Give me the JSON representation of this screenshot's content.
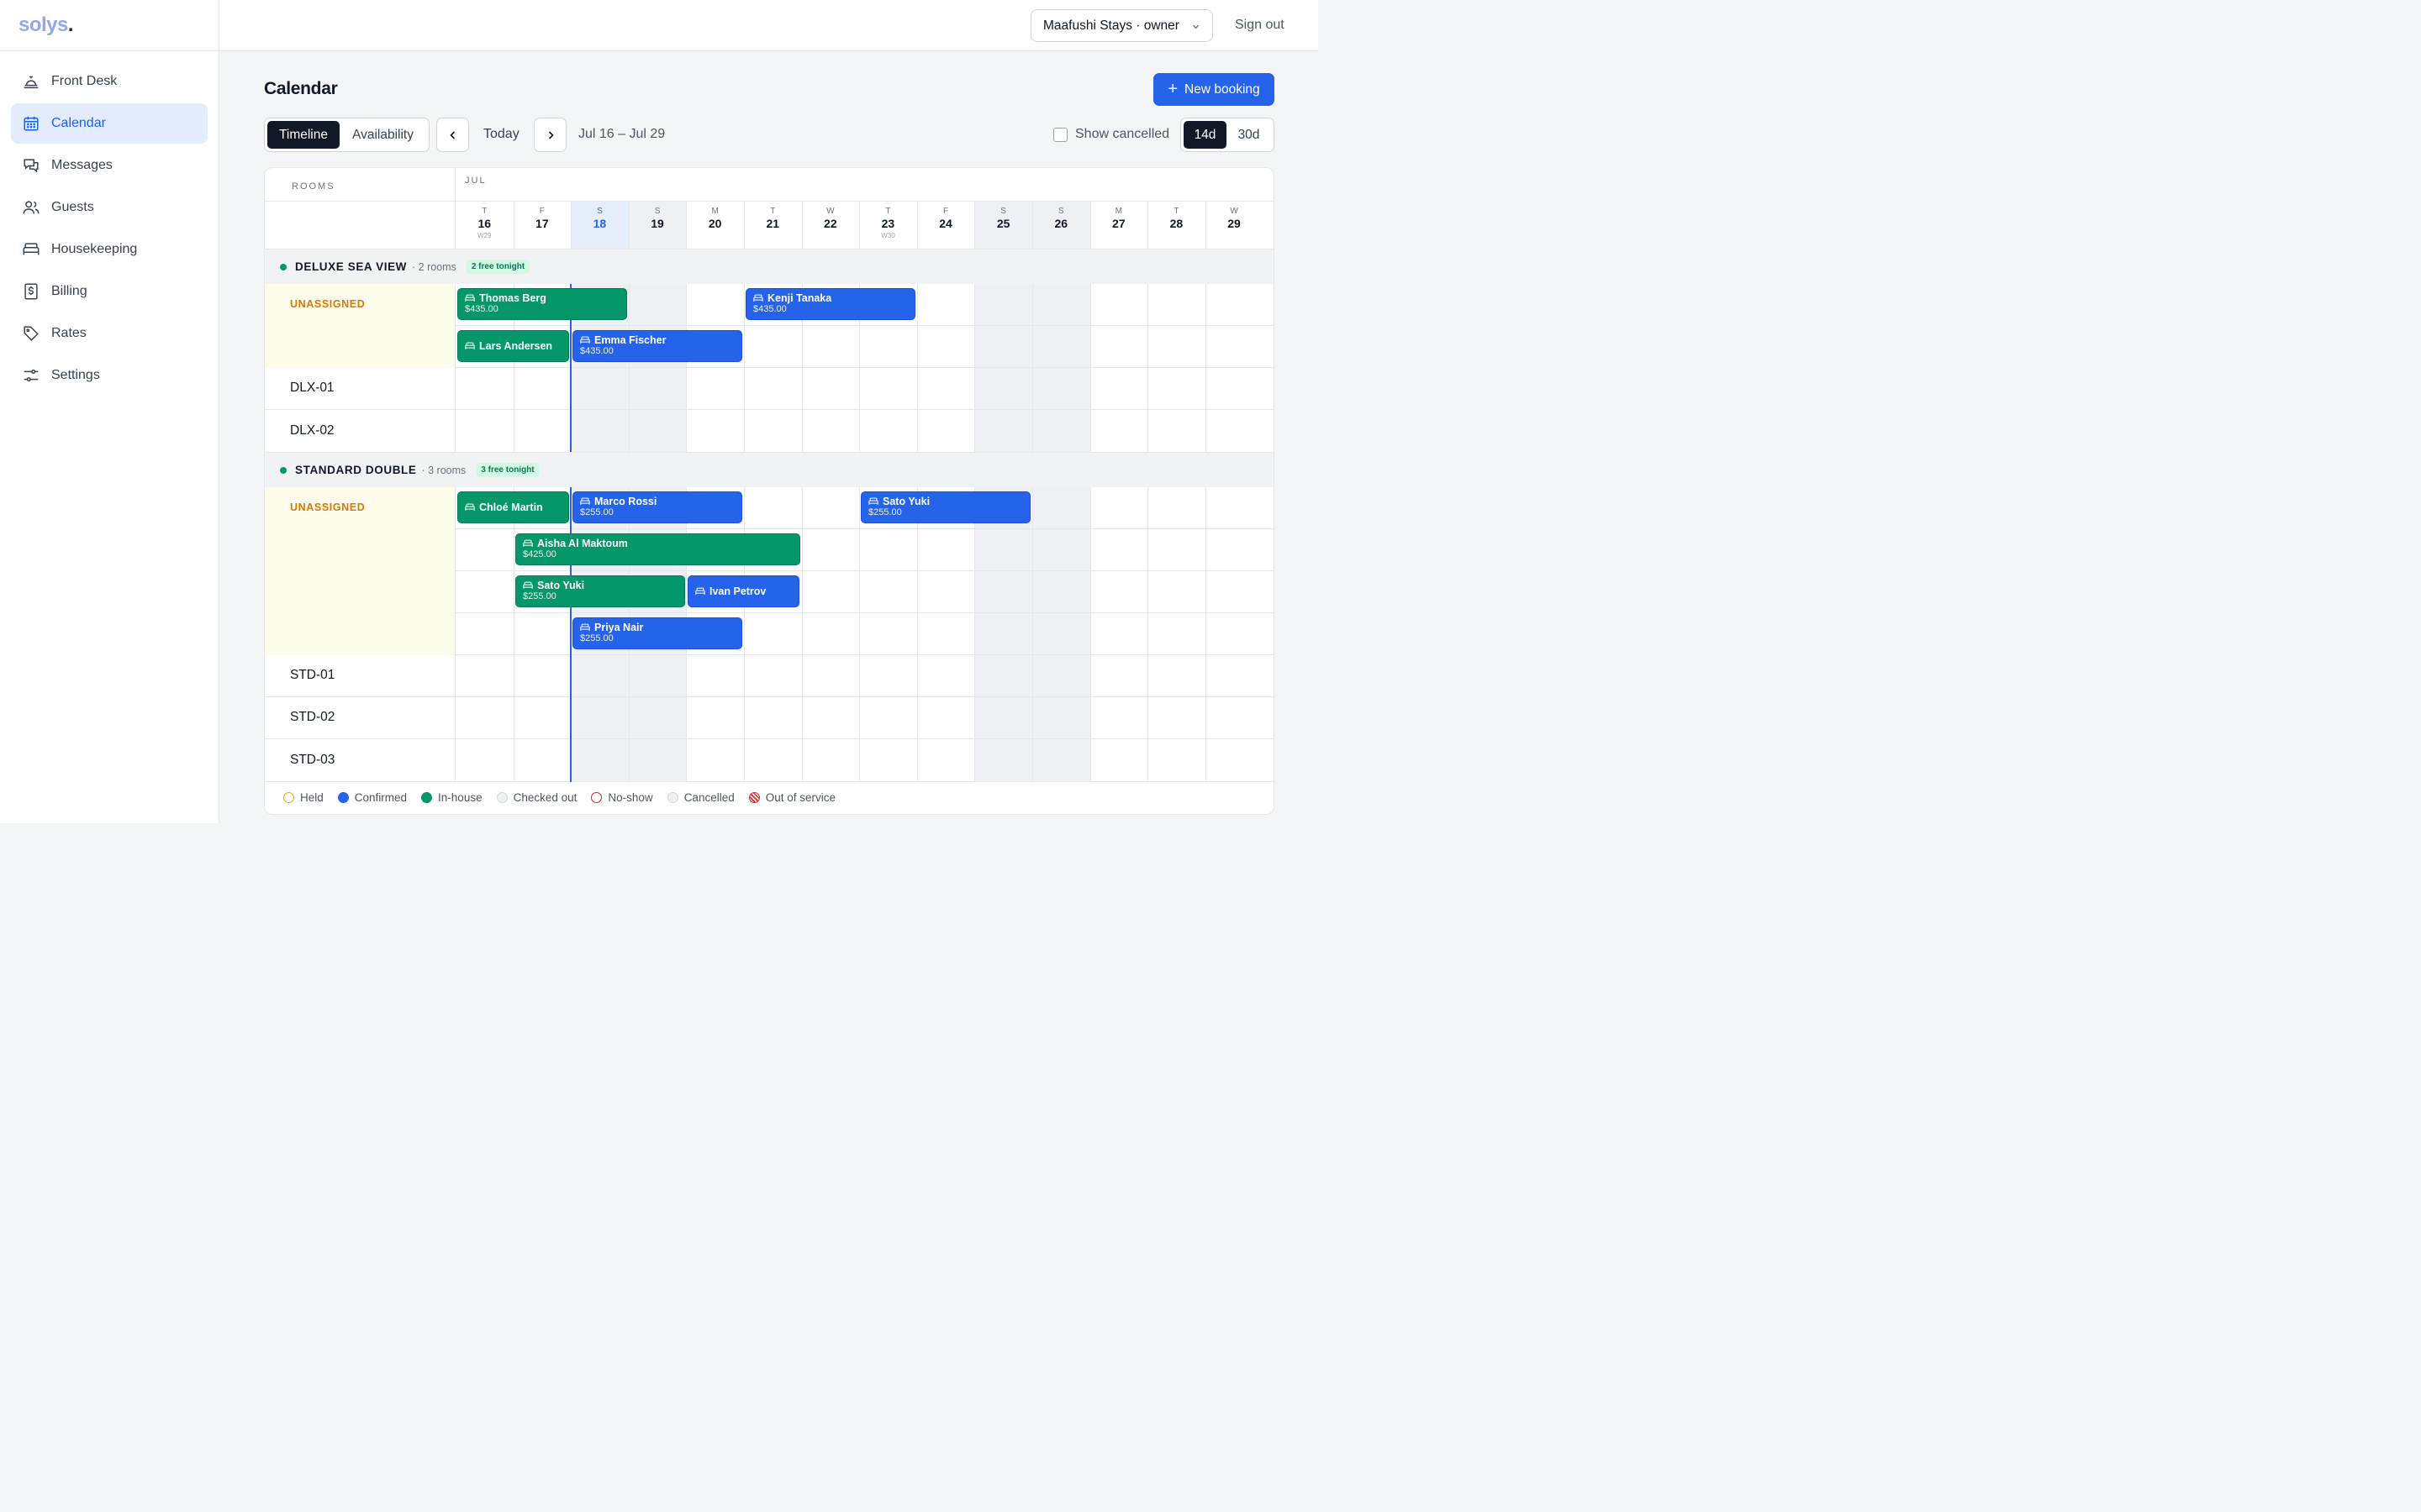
{
  "app": {
    "logo": "solys",
    "logo_dot": "."
  },
  "sidebar": {
    "items": [
      {
        "label": "Front Desk",
        "icon": "bell-icon"
      },
      {
        "label": "Calendar",
        "icon": "calendar-icon",
        "active": true
      },
      {
        "label": "Messages",
        "icon": "messages-icon"
      },
      {
        "label": "Guests",
        "icon": "users-icon"
      },
      {
        "label": "Housekeeping",
        "icon": "bed-icon"
      },
      {
        "label": "Billing",
        "icon": "dollar-icon"
      },
      {
        "label": "Rates",
        "icon": "tag-icon"
      },
      {
        "label": "Settings",
        "icon": "sliders-icon"
      }
    ]
  },
  "topbar": {
    "property": "Maafushi Stays · owner",
    "sign_out": "Sign out"
  },
  "header": {
    "title": "Calendar",
    "new_booking": "New booking",
    "views": [
      "Timeline",
      "Availability"
    ],
    "today": "Today",
    "range": "Jul 16 – Jul 29",
    "show_cancelled": "Show cancelled",
    "spans": [
      "14d",
      "30d"
    ]
  },
  "calendar": {
    "rooms_header": "ROOMS",
    "month": "JUL",
    "days": [
      {
        "dow": "T",
        "num": "16",
        "week": "W29"
      },
      {
        "dow": "F",
        "num": "17"
      },
      {
        "dow": "S",
        "num": "18",
        "today": true
      },
      {
        "dow": "S",
        "num": "19"
      },
      {
        "dow": "M",
        "num": "20"
      },
      {
        "dow": "T",
        "num": "21"
      },
      {
        "dow": "W",
        "num": "22"
      },
      {
        "dow": "T",
        "num": "23",
        "week": "W30"
      },
      {
        "dow": "F",
        "num": "24"
      },
      {
        "dow": "S",
        "num": "25"
      },
      {
        "dow": "S",
        "num": "26"
      },
      {
        "dow": "M",
        "num": "27"
      },
      {
        "dow": "T",
        "num": "28"
      },
      {
        "dow": "W",
        "num": "29"
      }
    ],
    "groups": [
      {
        "name": "DELUXE SEA VIEW",
        "count": "· 2 rooms",
        "badge": "2 free tonight",
        "unassigned_label": "UNASSIGNED",
        "rooms": [
          "DLX-01",
          "DLX-02"
        ]
      },
      {
        "name": "STANDARD DOUBLE",
        "count": "· 3 rooms",
        "badge": "3 free tonight",
        "unassigned_label": "UNASSIGNED",
        "rooms": [
          "STD-01",
          "STD-02",
          "STD-03"
        ]
      }
    ],
    "bookings": [
      {
        "guest": "Thomas Berg",
        "price": "$435.00",
        "status": "in-house",
        "start": 0,
        "nights": 3,
        "group": 0,
        "lane": 0
      },
      {
        "guest": "Kenji Tanaka",
        "price": "$435.00",
        "status": "confirmed",
        "start": 5,
        "nights": 3,
        "group": 0,
        "lane": 0
      },
      {
        "guest": "Lars Andersen",
        "price": "",
        "status": "in-house",
        "start": 0,
        "nights": 2,
        "group": 0,
        "lane": 1
      },
      {
        "guest": "Emma Fischer",
        "price": "$435.00",
        "status": "confirmed",
        "start": 2,
        "nights": 3,
        "group": 0,
        "lane": 1
      },
      {
        "guest": "Chloé Martin",
        "price": "",
        "status": "in-house",
        "start": 0,
        "nights": 2,
        "group": 1,
        "lane": 0
      },
      {
        "guest": "Marco Rossi",
        "price": "$255.00",
        "status": "confirmed",
        "start": 2,
        "nights": 3,
        "group": 1,
        "lane": 0
      },
      {
        "guest": "Sato Yuki",
        "price": "$255.00",
        "status": "confirmed",
        "start": 7,
        "nights": 3,
        "group": 1,
        "lane": 0
      },
      {
        "guest": "Aisha Al Maktoum",
        "price": "$425.00",
        "status": "in-house",
        "start": 1,
        "nights": 5,
        "group": 1,
        "lane": 1
      },
      {
        "guest": "Sato Yuki",
        "price": "$255.00",
        "status": "in-house",
        "start": 1,
        "nights": 3,
        "group": 1,
        "lane": 2
      },
      {
        "guest": "Ivan Petrov",
        "price": "",
        "status": "confirmed",
        "start": 4,
        "nights": 2,
        "group": 1,
        "lane": 2
      },
      {
        "guest": "Priya Nair",
        "price": "$255.00",
        "status": "confirmed",
        "start": 2,
        "nights": 3,
        "group": 1,
        "lane": 3
      }
    ]
  },
  "legend": [
    {
      "label": "Held",
      "color": "#f59e0b",
      "style": "ring"
    },
    {
      "label": "Confirmed",
      "color": "#2563eb",
      "style": "fill"
    },
    {
      "label": "In-house",
      "color": "#059669",
      "style": "fill"
    },
    {
      "label": "Checked out",
      "color": "#e5e7eb",
      "style": "fill"
    },
    {
      "label": "No-show",
      "color": "#dc2626",
      "style": "ring"
    },
    {
      "label": "Cancelled",
      "color": "#e5e7eb",
      "style": "fill"
    },
    {
      "label": "Out of service",
      "color": "#dc2626",
      "style": "hatch"
    }
  ],
  "colors": {
    "accent": "#2563eb",
    "in_house": "#059669",
    "unassigned": "#d97706"
  }
}
